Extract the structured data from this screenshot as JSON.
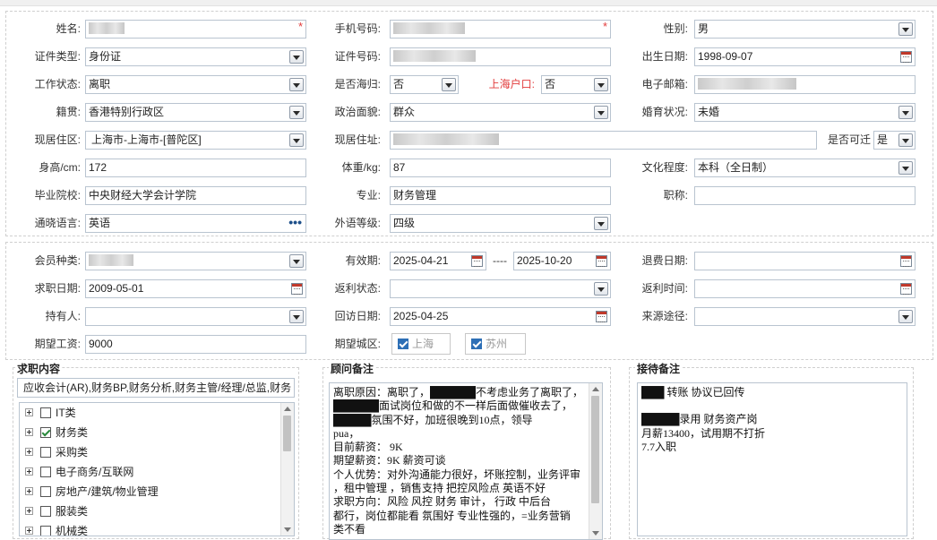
{
  "form": {
    "name": {
      "label": "姓名:",
      "value": "█████",
      "required": "*"
    },
    "phone": {
      "label": "手机号码:",
      "value": "█████████",
      "required": "*"
    },
    "gender": {
      "label": "性别:",
      "value": "男"
    },
    "id_type": {
      "label": "证件类型:",
      "value": "身份证"
    },
    "id_number": {
      "label": "证件号码:",
      "value": "██████████████"
    },
    "birth_date": {
      "label": "出生日期:",
      "value": "1998-09-07"
    },
    "work_status": {
      "label": "工作状态:",
      "value": "离职"
    },
    "returnee": {
      "label": "是否海归:",
      "value": "否"
    },
    "shanghai_hukou": {
      "label": "上海户口:",
      "value": "否"
    },
    "email": {
      "label": "电子邮箱:",
      "value": "████████████"
    },
    "native_place": {
      "label": "籍贯:",
      "value": "香港特别行政区"
    },
    "political_status": {
      "label": "政治面貌:",
      "value": "群众"
    },
    "marital_status": {
      "label": "婚育状况:",
      "value": "未婚"
    },
    "current_area": {
      "label": "现居住区:",
      "value": "上海市-上海市-[普陀区]"
    },
    "current_address": {
      "label": "现居住址:",
      "value": "█████████"
    },
    "relocate": {
      "label": "是否可迁",
      "value": "是"
    },
    "height": {
      "label": "身高/cm:",
      "value": "172"
    },
    "weight": {
      "label": "体重/kg:",
      "value": "87"
    },
    "education": {
      "label": "文化程度:",
      "value": "本科（全日制）"
    },
    "school": {
      "label": "毕业院校:",
      "value": "中央财经大学会计学院"
    },
    "major": {
      "label": "专业:",
      "value": "财务管理"
    },
    "title": {
      "label": "职称:",
      "value": ""
    },
    "language": {
      "label": "通晓语言:",
      "value": "英语"
    },
    "foreign_level": {
      "label": "外语等级:",
      "value": "四级"
    }
  },
  "membership": {
    "member_type": {
      "label": "会员种类:",
      "value": "████"
    },
    "validity": {
      "label": "有效期:",
      "start": "2025-04-21",
      "sep": "----",
      "end": "2025-10-20"
    },
    "refund_date": {
      "label": "退费日期:",
      "value": ""
    },
    "job_date": {
      "label": "求职日期:",
      "value": "2009-05-01"
    },
    "rebate_status": {
      "label": "返利状态:",
      "value": ""
    },
    "rebate_time": {
      "label": "返利时间:",
      "value": ""
    },
    "holder": {
      "label": "持有人:",
      "value": ""
    },
    "visit_date": {
      "label": "回访日期:",
      "value": "2025-04-25"
    },
    "source": {
      "label": "来源途径:",
      "value": ""
    },
    "expected_salary": {
      "label": "期望工资:",
      "value": "9000"
    },
    "expected_city": {
      "label": "期望城区:",
      "cities": [
        "上海",
        "苏州"
      ]
    }
  },
  "job_content": {
    "title": "求职内容",
    "summary": "应收会计(AR),财务BP,财务分析,财务主管/经理/总监,财务",
    "tree": [
      {
        "label": "IT类",
        "checked": false
      },
      {
        "label": "财务类",
        "checked": true
      },
      {
        "label": "采购类",
        "checked": false
      },
      {
        "label": "电子商务/互联网",
        "checked": false
      },
      {
        "label": "房地产/建筑/物业管理",
        "checked": false
      },
      {
        "label": "服装类",
        "checked": false
      },
      {
        "label": "机械类",
        "checked": false
      }
    ]
  },
  "advisor_notes": {
    "title": "顾问备注",
    "lines": [
      "离职原因：离职了，██████不考虑业务了离职了，",
      "██████面试岗位和做的不一样后面做催收去了，",
      "█████氛围不好，加班很晚到10点，领导",
      "pua，",
      "目前薪资： 9K",
      "期望薪资：9K  薪资可谈",
      "个人优势：对外沟通能力很好，坏账控制，业务评审",
      "，租中管理 ，销售支持 把控风险点  英语不好",
      "求职方向：风险 风控 财务  审计，  行政 中后台",
      "都行，岗位都能看 氛围好 专业性强的，=业务营销",
      "类不看"
    ]
  },
  "reception_notes": {
    "title": "接待备注",
    "lines": [
      "███ 转账 协议已回传",
      "",
      "█████录用   财务资产岗",
      "月薪13400，试用期不打折",
      "7.7入职"
    ]
  }
}
